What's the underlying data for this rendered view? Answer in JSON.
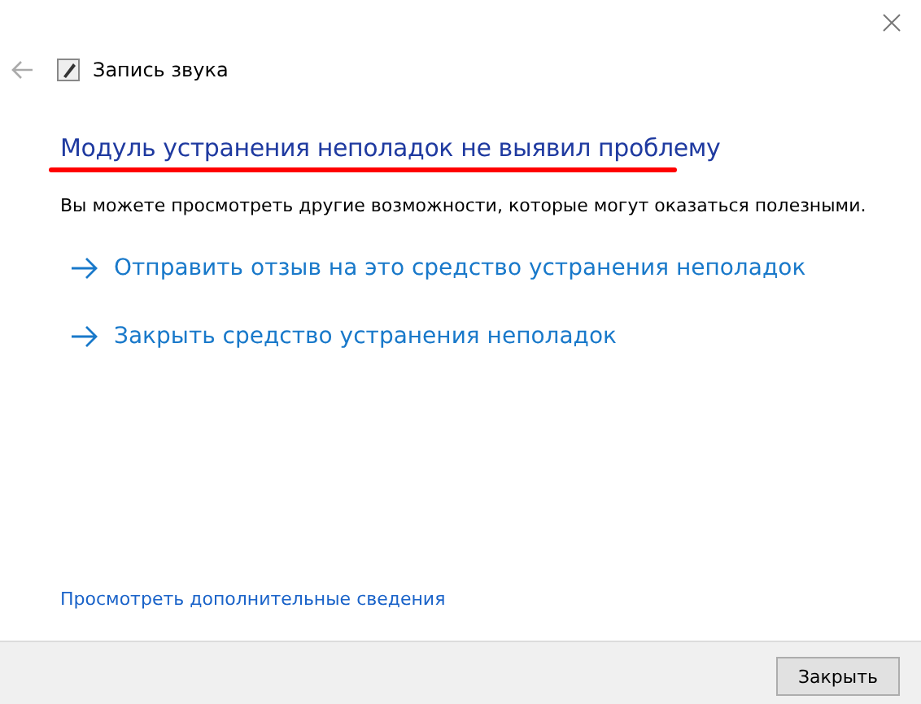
{
  "window": {
    "title": "Запись звука"
  },
  "heading": "Модуль устранения неполадок не выявил проблему",
  "message": "Вы можете просмотреть другие возможности, которые могут оказаться полезными.",
  "options": [
    {
      "label": "Отправить отзыв на это средство устранения неполадок"
    },
    {
      "label": "Закрыть средство устранения неполадок"
    }
  ],
  "details_link": "Просмотреть дополнительные сведения",
  "buttons": [
    "Закрыть"
  ]
}
